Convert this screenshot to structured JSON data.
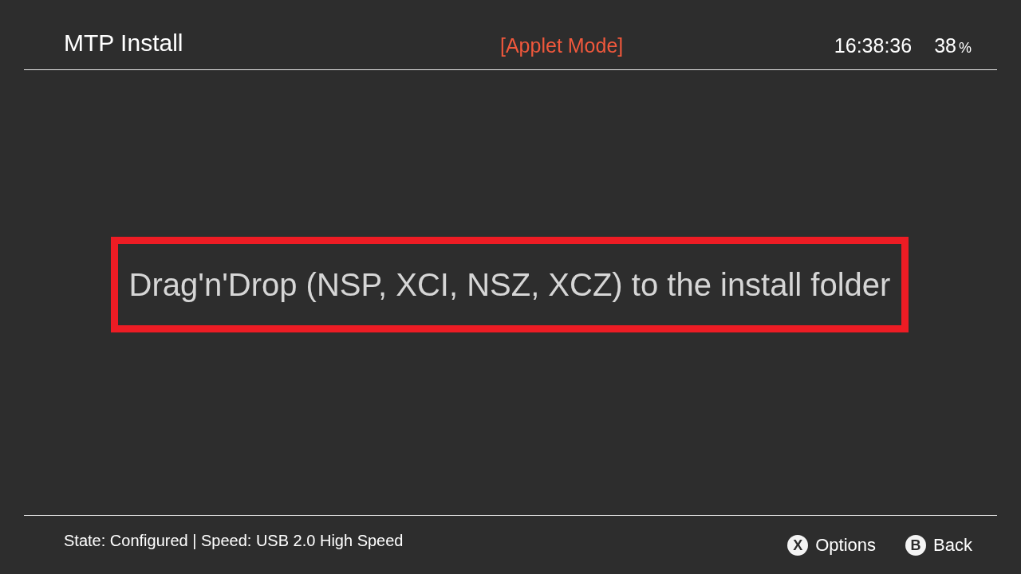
{
  "header": {
    "title": "MTP Install",
    "mode": "[Applet Mode]",
    "clock": "16:38:36",
    "battery": {
      "value": "38",
      "unit": "%"
    }
  },
  "message": {
    "text": "Drag'n'Drop (NSP, XCI, NSZ, XCZ) to the install folder",
    "highlighted": true
  },
  "footer": {
    "status": "State: Configured | Speed: USB 2.0 High Speed",
    "hints": [
      {
        "glyph": "X",
        "label": "Options"
      },
      {
        "glyph": "B",
        "label": "Back"
      }
    ]
  }
}
